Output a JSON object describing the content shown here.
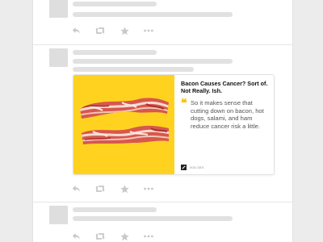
{
  "card": {
    "title": "Bacon Causes Cancer? Sort of. Not Really. Ish.",
    "quote_mark": "❝",
    "quote": "So it makes sense that cutting down on bacon, hot dogs, salami, and ham reduce cancer risk a little.",
    "source": "vox.com",
    "image_background": "#ffd21f",
    "quote_accent": "#ffc107"
  },
  "actions": [
    "reply-icon",
    "retweet-icon",
    "like-icon",
    "more-icon"
  ],
  "colors": {
    "placeholder": "#e1e1e1",
    "avatar": "#dedede",
    "icon": "#c8c8c8",
    "page_background": "#ececec"
  }
}
